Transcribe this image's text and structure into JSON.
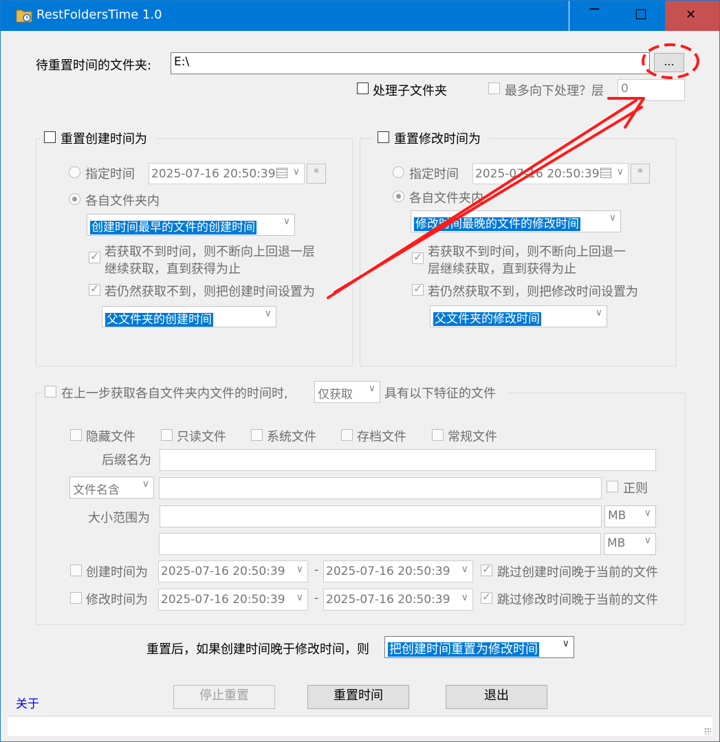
{
  "window": {
    "title": "RestFoldersTime 1.0",
    "min_glyph": "‒",
    "max_glyph": "☐",
    "close_glyph": "✕"
  },
  "folder": {
    "label": "待重置时间的文件夹:",
    "value": "E:\\",
    "browse_label": "..."
  },
  "subfolders": {
    "process_label": "处理子文件夹",
    "process_checked": false,
    "max_depth_label": "最多向下处理？层",
    "depth_value": "0"
  },
  "create_group": {
    "title": "重置创建时间为",
    "checked": false,
    "specified_label": "指定时间",
    "specified_value": "2025-07-16 20:50:39",
    "star": "*",
    "each_label": "各自文件夹内",
    "mode_value": "创建时间最早的文件的创建时间",
    "fallback_up_line1": "若获取不到时间，则不断向上回退一层",
    "fallback_up_line2": "继续获取，直到获得为止",
    "fallback_set_label": "若仍然获取不到，则把创建时间设置为",
    "fallback_value": "父文件夹的创建时间"
  },
  "modify_group": {
    "title": "重置修改时间为",
    "checked": false,
    "specified_label": "指定时间",
    "specified_value": "2025-07-16 20:50:39",
    "star": "*",
    "each_label": "各自文件夹内",
    "mode_value": "修改时间最晚的文件的修改时间",
    "fallback_up_line1": "若获取不到时间，则不断向上回退一",
    "fallback_up_line2": "层继续获取，直到获得为止",
    "fallback_set_label": "若仍然获取不到，则把修改时间设置为",
    "fallback_value": "父文件夹的修改时间"
  },
  "filter": {
    "prefix": "在上一步获取各自文件夹内文件的时间时,",
    "mode_value": "仅获取",
    "suffix": "具有以下特征的文件",
    "attrs": [
      "隐藏文件",
      "只读文件",
      "系统文件",
      "存档文件",
      "常规文件"
    ],
    "ext_label": "后缀名为",
    "name_mode": "文件名含",
    "regex_label": "正则",
    "size_label": "大小范围为",
    "unit1": "MB",
    "unit2": "MB",
    "ctime_label": "创建时间为",
    "ctime_from": "2025-07-16 20:50:39",
    "ctime_to": "2025-07-16 20:50:39",
    "ctime_skip": "跳过创建时间晚于当前的文件",
    "mtime_label": "修改时间为",
    "mtime_from": "2025-07-16 20:50:39",
    "mtime_to": "2025-07-16 20:50:39",
    "mtime_skip": "跳过修改时间晚于当前的文件",
    "dash": "-"
  },
  "after": {
    "label": "重置后，如果创建时间晚于修改时间，则",
    "value": "把创建时间重置为修改时间"
  },
  "actions": {
    "about": "关于",
    "stop": "停止重置",
    "reset": "重置时间",
    "exit": "退出"
  },
  "dropdown_arrow": "∨",
  "colors": {
    "title_bar": "#0078d7",
    "close_button": "#c75050",
    "selection": "#0078d7",
    "annotation": "#ff0000"
  }
}
